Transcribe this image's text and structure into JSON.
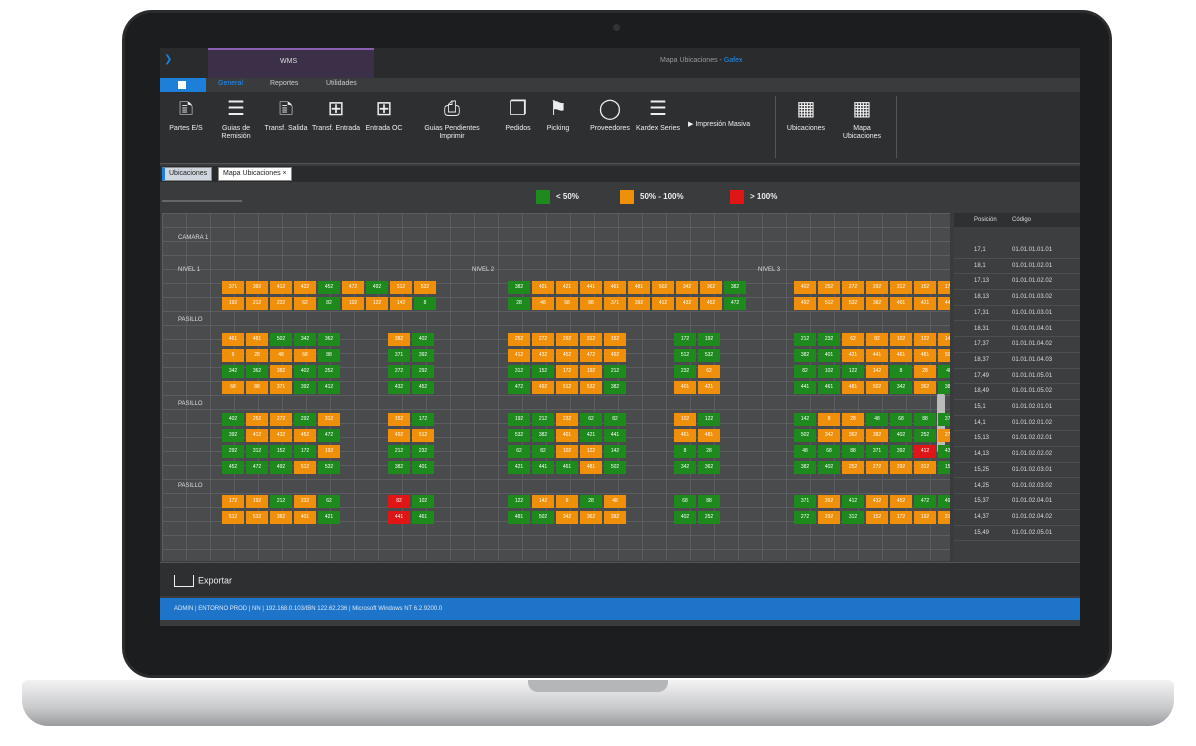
{
  "window": {
    "app_tab": "WMS",
    "title_prefix": "Mapa Ubicaciones - ",
    "title_brand": "Gafex"
  },
  "ribbon": {
    "tabs": [
      "General",
      "Reportes",
      "Utilidades"
    ],
    "buttons": [
      {
        "label": "Partes E/S",
        "icon": "document-icon"
      },
      {
        "label": "Guias de Remisión",
        "icon": "layers-icon"
      },
      {
        "label": "Transf. Salida",
        "icon": "document-icon"
      },
      {
        "label": "Transf. Entrada",
        "icon": "document-plus-icon"
      },
      {
        "label": "Entrada OC",
        "icon": "document-plus-icon"
      },
      {
        "label": "Guias Pendientes Imprimir",
        "icon": "printer-icon"
      },
      {
        "label": "Pedidos",
        "icon": "documents-icon"
      },
      {
        "label": "Picking",
        "icon": "cart-icon"
      },
      {
        "label": "Proveedores",
        "icon": "user-icon"
      },
      {
        "label": "Kardex Series",
        "icon": "layers-icon"
      },
      {
        "label": "Ubicaciones",
        "icon": "list-icon"
      },
      {
        "label": "Mapa Ubicaciones",
        "icon": "grid-icon"
      }
    ],
    "impresion_masiva": "Impresión Masiva"
  },
  "doc_tabs": [
    "Ubicaciones",
    "Mapa Ubicaciones"
  ],
  "legend": [
    {
      "label": "< 50%",
      "color": "#1e8a1e"
    },
    {
      "label": "50% - 100%",
      "color": "#f0900a"
    },
    {
      "label": "> 100%",
      "color": "#e01515"
    }
  ],
  "map": {
    "labels": {
      "camara": "CAMARA 1",
      "nivel1": "NIVEL 1",
      "nivel2": "NIVEL 2",
      "nivel3": "NIVEL 3",
      "pasillo1": "PASILLO",
      "pasillo2": "PASILLO",
      "pasillo3": "PASILLO"
    },
    "block_rows": [
      {
        "l": "oooogogoo",
        "m": "goooooooog",
        "r": "ooooooo"
      },
      {
        "l": "oooogooog",
        "m": "goooooooog",
        "r": "ooooooo"
      },
      {
        "l": "ooggg",
        "s": "og",
        "m": "ooooo",
        "t": "gg",
        "r": "ggooooo"
      },
      {
        "l": "oooog",
        "s": "gg",
        "m": "ooooo",
        "t": "gg",
        "r": "ggooooo"
      },
      {
        "l": "ggogg",
        "s": "gg",
        "m": "ggoog",
        "t": "go",
        "r": "gggogog"
      },
      {
        "l": "ooogg",
        "s": "gg",
        "m": "gooog",
        "t": "oo",
        "r": "ggoogog"
      },
      {
        "l": "googo",
        "s": "og",
        "m": "ggogg",
        "t": "og",
        "r": "googggg"
      },
      {
        "l": "gooog",
        "s": "oo",
        "m": "ggogg",
        "t": "oo",
        "r": "goooggo"
      },
      {
        "l": "ggggo",
        "s": "gg",
        "m": "ggoog",
        "t": "gg",
        "r": "gggggrg"
      },
      {
        "l": "gggog",
        "s": "gg",
        "m": "gggog",
        "t": "gg",
        "r": "ggoooog"
      },
      {
        "l": "oogog",
        "s": "rg",
        "m": "googo",
        "t": "gg",
        "r": "gogoogg"
      },
      {
        "l": "oooog",
        "s": "rg",
        "m": "ggooo",
        "t": "gg",
        "r": "gogoooo"
      }
    ],
    "cell_nums": [
      "371",
      "392",
      "412",
      "432",
      "452",
      "472",
      "492",
      "512",
      "532",
      "382",
      "401",
      "421",
      "441",
      "461",
      "481",
      "502",
      "342",
      "362",
      "382",
      "402",
      "252",
      "272",
      "292",
      "312",
      "152",
      "172",
      "192",
      "212",
      "232",
      "62",
      "82",
      "102",
      "122",
      "142",
      "8",
      "28",
      "48",
      "68",
      "88"
    ]
  },
  "right_panel": {
    "headers": [
      "Posición",
      "Código"
    ],
    "rows": [
      {
        "p": "17,1",
        "c": "01.01.01.01.01"
      },
      {
        "p": "18,1",
        "c": "01.01.01.02.01"
      },
      {
        "p": "17,13",
        "c": "01.01.01.02.02"
      },
      {
        "p": "18,13",
        "c": "01.01.01.03.02"
      },
      {
        "p": "17,31",
        "c": "01.01.01.03.01"
      },
      {
        "p": "18,31",
        "c": "01.01.01.04.01"
      },
      {
        "p": "17,37",
        "c": "01.01.01.04.02"
      },
      {
        "p": "18,37",
        "c": "01.01.01.04.03"
      },
      {
        "p": "17,49",
        "c": "01.01.01.05.01"
      },
      {
        "p": "18,49",
        "c": "01.01.01.05.02"
      },
      {
        "p": "15,1",
        "c": "01.01.02.01.01"
      },
      {
        "p": "14,1",
        "c": "01.01.02.01.02"
      },
      {
        "p": "15,13",
        "c": "01.01.02.02.01"
      },
      {
        "p": "14,13",
        "c": "01.01.02.02.02"
      },
      {
        "p": "15,25",
        "c": "01.01.02.03.01"
      },
      {
        "p": "14,25",
        "c": "01.01.02.03.02"
      },
      {
        "p": "15,37",
        "c": "01.01.02.04.01"
      },
      {
        "p": "14,37",
        "c": "01.01.02.04.02"
      },
      {
        "p": "15,49",
        "c": "01.01.02.05.01"
      }
    ]
  },
  "footer": {
    "export_label": "Exportar"
  },
  "status": "ADMIN  |  ENTORNO PROD  |  NN  |  192.168.0.103/IBN 122.62.236  |  Microsoft Windows NT 6.2.9200.0"
}
